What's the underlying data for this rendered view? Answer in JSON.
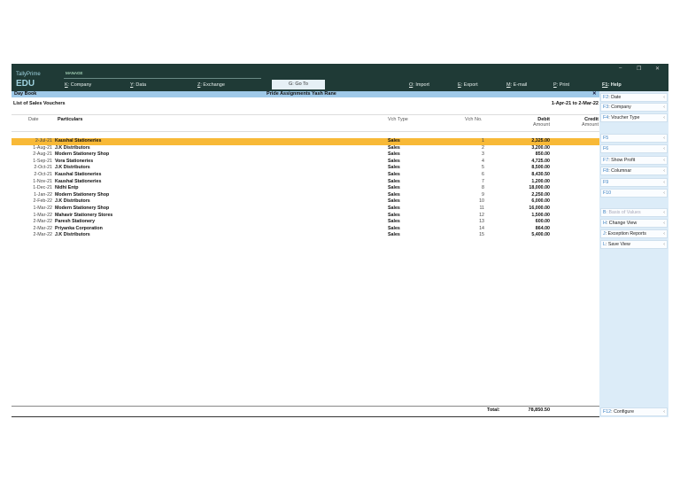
{
  "app": {
    "brand": "TallyPrime",
    "edition": "EDU",
    "manage_label": "MANAGE",
    "goto": "G: Go To"
  },
  "menu": [
    {
      "key": "K",
      "label": ": Company"
    },
    {
      "key": "Y",
      "label": ": Data"
    },
    {
      "key": "Z",
      "label": ": Exchange"
    },
    {
      "key": "O",
      "label": ": Import"
    },
    {
      "key": "E",
      "label": ": Export"
    },
    {
      "key": "M",
      "label": ": E-mail"
    },
    {
      "key": "P",
      "label": ": Print"
    },
    {
      "key": "F1",
      "label": ": Help"
    }
  ],
  "window": {
    "minimize": "–",
    "restore": "❐",
    "close": "✕"
  },
  "report": {
    "title": "Day Book",
    "company": "Pride Assignments Yash Rane",
    "close": "✕",
    "subtitle": "List of Sales Vouchers",
    "period": "1-Apr-21 to 2-Mar-22"
  },
  "columns": {
    "date": "Date",
    "particulars": "Particulars",
    "vch_type": "Vch Type",
    "vch_no": "Vch No.",
    "debit": "Debit",
    "debit_sub": "Amount",
    "credit": "Credit",
    "credit_sub": "Amount"
  },
  "rows": [
    {
      "date": "2-Jul-21",
      "particulars": "Kaushal Stationeries",
      "type": "Sales",
      "no": "1",
      "debit": "2,325.00"
    },
    {
      "date": "1-Aug-21",
      "particulars": "J.K Distributors",
      "type": "Sales",
      "no": "2",
      "debit": "3,200.00"
    },
    {
      "date": "2-Aug-21",
      "particulars": "Modern Stationery Shop",
      "type": "Sales",
      "no": "3",
      "debit": "850.00"
    },
    {
      "date": "1-Sep-21",
      "particulars": "Vora Stationeries",
      "type": "Sales",
      "no": "4",
      "debit": "4,725.00"
    },
    {
      "date": "2-Oct-21",
      "particulars": "J.K Distributors",
      "type": "Sales",
      "no": "5",
      "debit": "8,500.00"
    },
    {
      "date": "2-Oct-21",
      "particulars": "Kaushal Stationeries",
      "type": "Sales",
      "no": "6",
      "debit": "8,430.50"
    },
    {
      "date": "1-Nov-21",
      "particulars": "Kaushal Stationeries",
      "type": "Sales",
      "no": "7",
      "debit": "1,200.00"
    },
    {
      "date": "1-Dec-21",
      "particulars": "Nidhi Entp",
      "type": "Sales",
      "no": "8",
      "debit": "18,000.00"
    },
    {
      "date": "1-Jan-22",
      "particulars": "Modern Stationery Shop",
      "type": "Sales",
      "no": "9",
      "debit": "2,250.00"
    },
    {
      "date": "2-Feb-22",
      "particulars": "J.K Distributors",
      "type": "Sales",
      "no": "10",
      "debit": "6,000.00"
    },
    {
      "date": "1-Mar-22",
      "particulars": "Modern Stationery Shop",
      "type": "Sales",
      "no": "11",
      "debit": "16,000.00"
    },
    {
      "date": "1-Mar-22",
      "particulars": "Mahavir Stationery Stores",
      "type": "Sales",
      "no": "12",
      "debit": "1,500.00"
    },
    {
      "date": "2-Mar-22",
      "particulars": "Paresh Stationery",
      "type": "Sales",
      "no": "13",
      "debit": "600.00"
    },
    {
      "date": "2-Mar-22",
      "particulars": "Priyanka Corporation",
      "type": "Sales",
      "no": "14",
      "debit": "864.00"
    },
    {
      "date": "2-Mar-22",
      "particulars": "J.K Distributors",
      "type": "Sales",
      "no": "15",
      "debit": "5,400.00"
    }
  ],
  "total": {
    "label": "Total:",
    "debit": "78,850.50"
  },
  "panel": [
    {
      "key": "F2",
      "label": ": Date",
      "enabled": true
    },
    {
      "key": "F3",
      "label": ": Company",
      "enabled": true
    },
    {
      "key": "F4",
      "label": ": Voucher Type",
      "enabled": true
    },
    {
      "key": "F5",
      "label": "",
      "enabled": false
    },
    {
      "key": "F6",
      "label": "",
      "enabled": false
    },
    {
      "key": "F7",
      "label": ": Show Profit",
      "enabled": true
    },
    {
      "key": "F8",
      "label": ": Columnar",
      "enabled": true
    },
    {
      "key": "F9",
      "label": "",
      "enabled": false
    },
    {
      "key": "F10",
      "label": "",
      "enabled": false
    },
    {
      "key": "B",
      "label": ": Basis of Values",
      "enabled": false
    },
    {
      "key": "H",
      "label": ": Change View",
      "enabled": true
    },
    {
      "key": "J",
      "label": ": Exception Reports",
      "enabled": true
    },
    {
      "key": "L",
      "label": ": Save View",
      "enabled": true
    },
    {
      "key": "F12",
      "label": ": Configure",
      "enabled": true
    }
  ]
}
